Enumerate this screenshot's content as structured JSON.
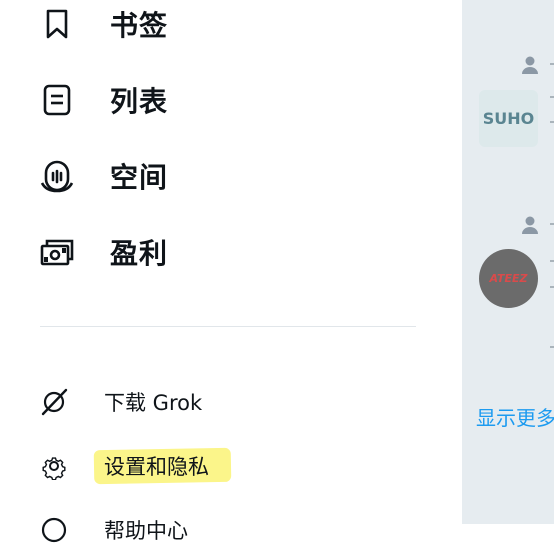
{
  "nav": {
    "items": [
      {
        "label": "书签",
        "icon": "bookmark-icon"
      },
      {
        "label": "列表",
        "icon": "list-icon"
      },
      {
        "label": "空间",
        "icon": "spaces-icon"
      },
      {
        "label": "盈利",
        "icon": "monetization-icon"
      }
    ]
  },
  "menu": {
    "items": [
      {
        "label": "下载 Grok",
        "icon": "grok-icon"
      },
      {
        "label": "设置和隐私",
        "icon": "gear-icon",
        "highlighted": true
      },
      {
        "label": "帮助中心",
        "icon": "help-icon"
      }
    ]
  },
  "side": {
    "avatar1_text": "SUHO",
    "avatar2_text": "ATEEZ",
    "show_more": "显示更多"
  },
  "colors": {
    "text": "#0f1419",
    "accent": "#1d9bf0",
    "highlight": "#fbf58a",
    "side_bg": "#e6ecf0"
  }
}
